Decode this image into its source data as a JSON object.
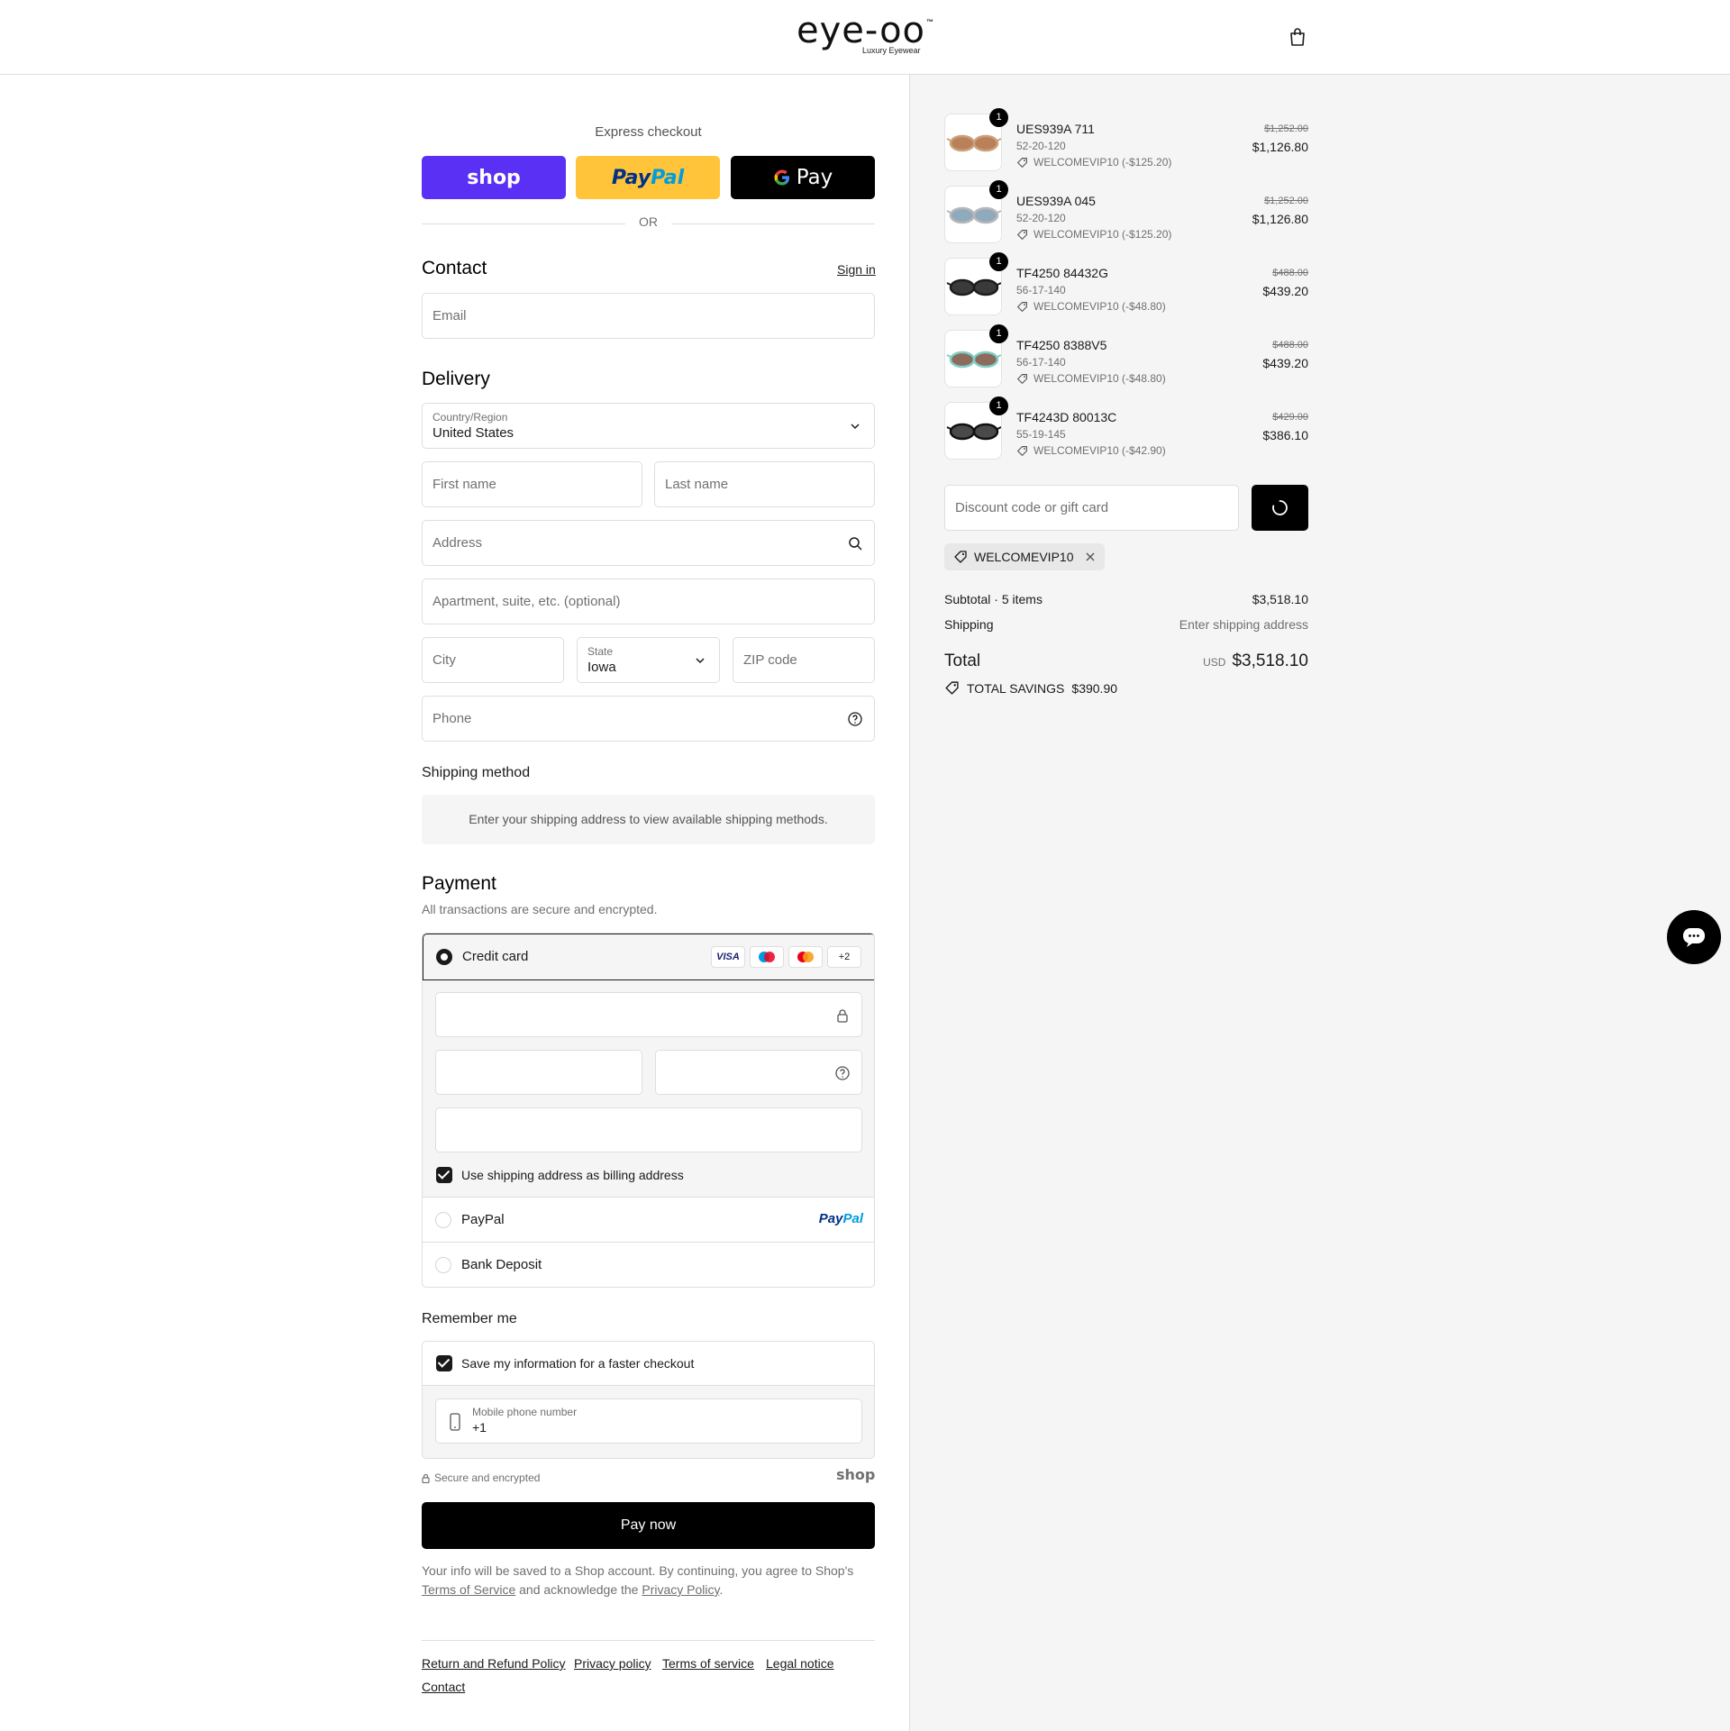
{
  "header": {
    "logo": "eye-oo",
    "logo_tm": "™",
    "logo_sub": "Luxury Eyewear"
  },
  "express": {
    "title": "Express checkout",
    "shop_label": "shop",
    "paypal_pay": "Pay",
    "paypal_pal": "Pal",
    "gpay_label": "Pay",
    "or": "OR"
  },
  "contact": {
    "title": "Contact",
    "sign_in": "Sign in",
    "email_placeholder": "Email"
  },
  "delivery": {
    "title": "Delivery",
    "country_label": "Country/Region",
    "country_value": "United States",
    "first_name": "First name",
    "last_name": "Last name",
    "address": "Address",
    "apartment": "Apartment, suite, etc. (optional)",
    "city": "City",
    "state_label": "State",
    "state_value": "Iowa",
    "zip": "ZIP code",
    "phone": "Phone"
  },
  "shipping_method": {
    "title": "Shipping method",
    "info": "Enter your shipping address to view available shipping methods."
  },
  "payment": {
    "title": "Payment",
    "subtitle": "All transactions are secure and encrypted.",
    "credit_card": "Credit card",
    "card_visa": "VISA",
    "card_more": "+2",
    "billing_checkbox": "Use shipping address as billing address",
    "paypal": "PayPal",
    "paypal_logo_pay": "Pay",
    "paypal_logo_pal": "Pal",
    "bank_deposit": "Bank Deposit"
  },
  "remember": {
    "title": "Remember me",
    "save_info": "Save my information for a faster checkout",
    "mobile_label": "Mobile phone number",
    "mobile_value": "+1",
    "secure": "Secure and encrypted",
    "shop": "shop"
  },
  "pay_now": "Pay now",
  "legal": {
    "line1": "Your info will be saved to a Shop account. By continuing, you agree to Shop's",
    "tos": "Terms of Service",
    "mid": "and acknowledge the",
    "privacy": "Privacy Policy",
    "end": "."
  },
  "footer_links": [
    "Return and Refund Policy",
    "Privacy policy",
    "Terms of service",
    "Legal notice",
    "Contact"
  ],
  "order": {
    "items": [
      {
        "name": "UES939A 711",
        "size": "52-20-120",
        "discount": "WELCOMEVIP10 (-$125.20)",
        "old_price": "$1,252.00",
        "price": "$1,126.80",
        "qty": "1",
        "lens_color": "#b9805a",
        "frame_color": "#c9a27a"
      },
      {
        "name": "UES939A 045",
        "size": "52-20-120",
        "discount": "WELCOMEVIP10 (-$125.20)",
        "old_price": "$1,252.00",
        "price": "$1,126.80",
        "qty": "1",
        "lens_color": "#8fa9bd",
        "frame_color": "#b8b8b8"
      },
      {
        "name": "TF4250 84432G",
        "size": "56-17-140",
        "discount": "WELCOMEVIP10 (-$48.80)",
        "old_price": "$488.00",
        "price": "$439.20",
        "qty": "1",
        "lens_color": "#3a3a3a",
        "frame_color": "#1c1c1c"
      },
      {
        "name": "TF4250 8388V5",
        "size": "56-17-140",
        "discount": "WELCOMEVIP10 (-$48.80)",
        "old_price": "$488.00",
        "price": "$439.20",
        "qty": "1",
        "lens_color": "#8c6a5c",
        "frame_color": "#7fcfc6"
      },
      {
        "name": "TF4243D 80013C",
        "size": "55-19-145",
        "discount": "WELCOMEVIP10 (-$42.90)",
        "old_price": "$429.00",
        "price": "$386.10",
        "qty": "1",
        "lens_color": "#4a4a4a",
        "frame_color": "#111111"
      }
    ],
    "discount_placeholder": "Discount code or gift card",
    "applied_code": "WELCOMEVIP10",
    "subtotal_label": "Subtotal · 5 items",
    "subtotal_value": "$3,518.10",
    "shipping_label": "Shipping",
    "shipping_value": "Enter shipping address",
    "total_label": "Total",
    "currency": "USD",
    "total_value": "$3,518.10",
    "savings_label": "TOTAL SAVINGS",
    "savings_value": "$390.90"
  }
}
